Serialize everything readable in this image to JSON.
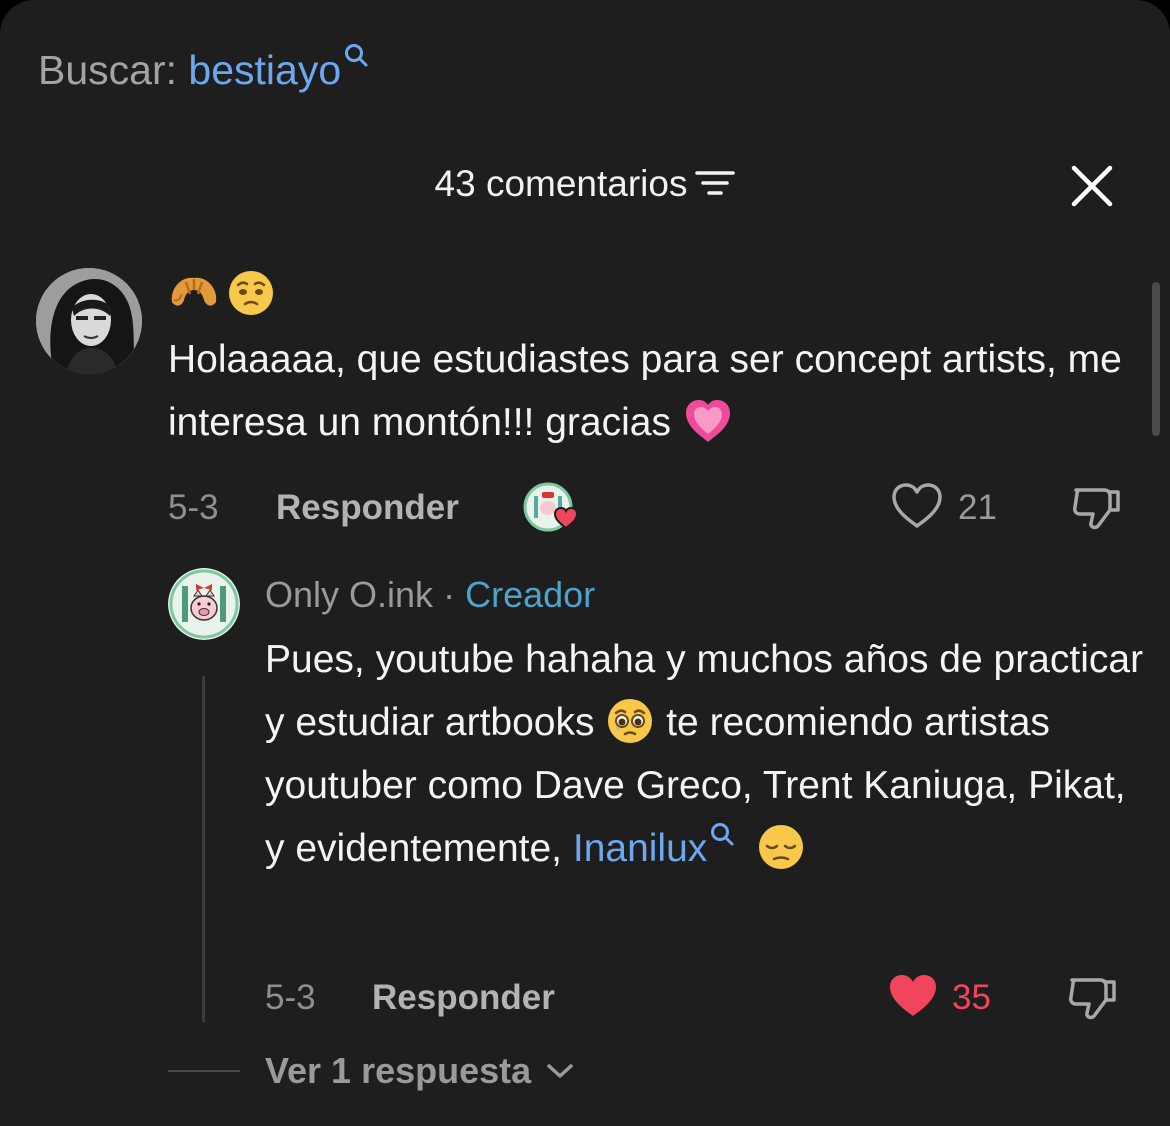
{
  "search": {
    "prefix": "Buscar:",
    "query": "bestiayo"
  },
  "header": {
    "count_label": "43 comentarios"
  },
  "comment1": {
    "text": "Holaaaaa, que estudiastes para ser concept artists, me interesa un montón!!! gracias",
    "date": "5-3",
    "reply_label": "Responder",
    "likes": "21",
    "liked_by_creator": true
  },
  "comment2": {
    "author": "Only O.ink",
    "separator": "·",
    "badge": "Creador",
    "text_part1": "Pues, youtube hahaha y muchos años de practicar y estudiar artbooks",
    "text_part2": "te recomiendo artistas youtuber como Dave Greco, Trent Kaniuga, Pikat, y evidentemente,",
    "mention": "Inanilux",
    "date": "5-3",
    "reply_label": "Responder",
    "likes": "35",
    "liked": true
  },
  "more_replies_label": "Ver 1 respuesta",
  "colors": {
    "background": "#1e1e1e",
    "link": "#6ca8f0",
    "creator": "#4fa3c8",
    "like_red": "#f0455c"
  },
  "icons": [
    "search-icon",
    "filter-icon",
    "close-icon",
    "croissant-emoji",
    "pleading-face-emoji",
    "pink-heart-emoji",
    "teary-face-emoji",
    "pensive-face-emoji",
    "heart-icon",
    "heart-filled-icon",
    "dislike-icon",
    "chevron-down-icon"
  ]
}
